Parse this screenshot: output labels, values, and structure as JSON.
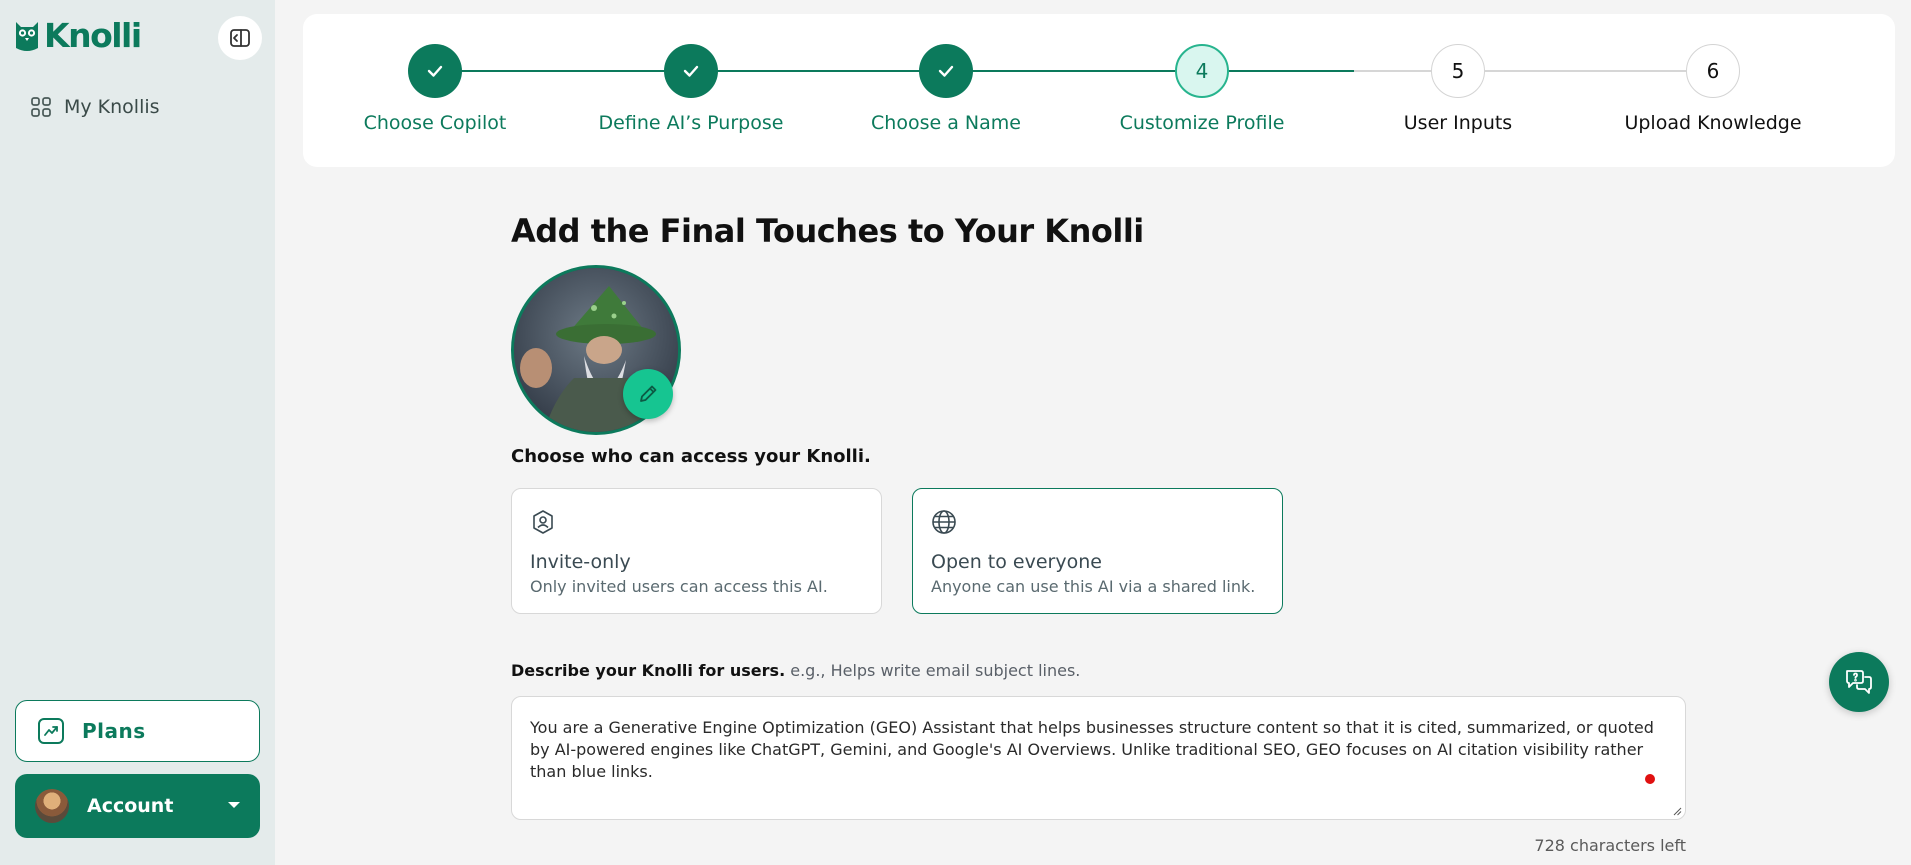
{
  "brand": {
    "name": "Knolli"
  },
  "sidebar": {
    "nav": [
      {
        "label": "My Knollis",
        "icon": "grid-icon"
      }
    ],
    "plans_label": "Plans",
    "account_label": "Account"
  },
  "stepper": {
    "steps": [
      {
        "number": "1",
        "label": "Choose Copilot",
        "state": "done"
      },
      {
        "number": "2",
        "label": "Define AI’s Purpose",
        "state": "done"
      },
      {
        "number": "3",
        "label": "Choose a Name",
        "state": "done"
      },
      {
        "number": "4",
        "label": "Customize Profile",
        "state": "active"
      },
      {
        "number": "5",
        "label": "User Inputs",
        "state": "todo"
      },
      {
        "number": "6",
        "label": "Upload Knowledge",
        "state": "todo"
      }
    ]
  },
  "main": {
    "title": "Add the Final Touches to Your Knolli",
    "access_label": "Choose who can access your Knolli.",
    "access_options": [
      {
        "title": "Invite-only",
        "desc": "Only invited users can access this AI.",
        "selected": false
      },
      {
        "title": "Open to everyone",
        "desc": "Anyone can use this AI via a shared link.",
        "selected": true
      }
    ],
    "describe_label": "Describe your Knolli for users.",
    "describe_hint": "e.g., Helps write email subject lines.",
    "describe_value": "You are a Generative Engine Optimization (GEO) Assistant that helps businesses structure content so that it is cited, summarized, or quoted by AI-powered engines like ChatGPT, Gemini, and Google's AI Overviews. Unlike traditional SEO, GEO focuses on AI citation visibility rather than blue links.",
    "chars_left": "728 characters left"
  },
  "colors": {
    "accent": "#0c7a5c",
    "accent_light": "#16c591",
    "sidebar_bg": "#e4ebeb",
    "page_bg": "#f4f4f4"
  }
}
